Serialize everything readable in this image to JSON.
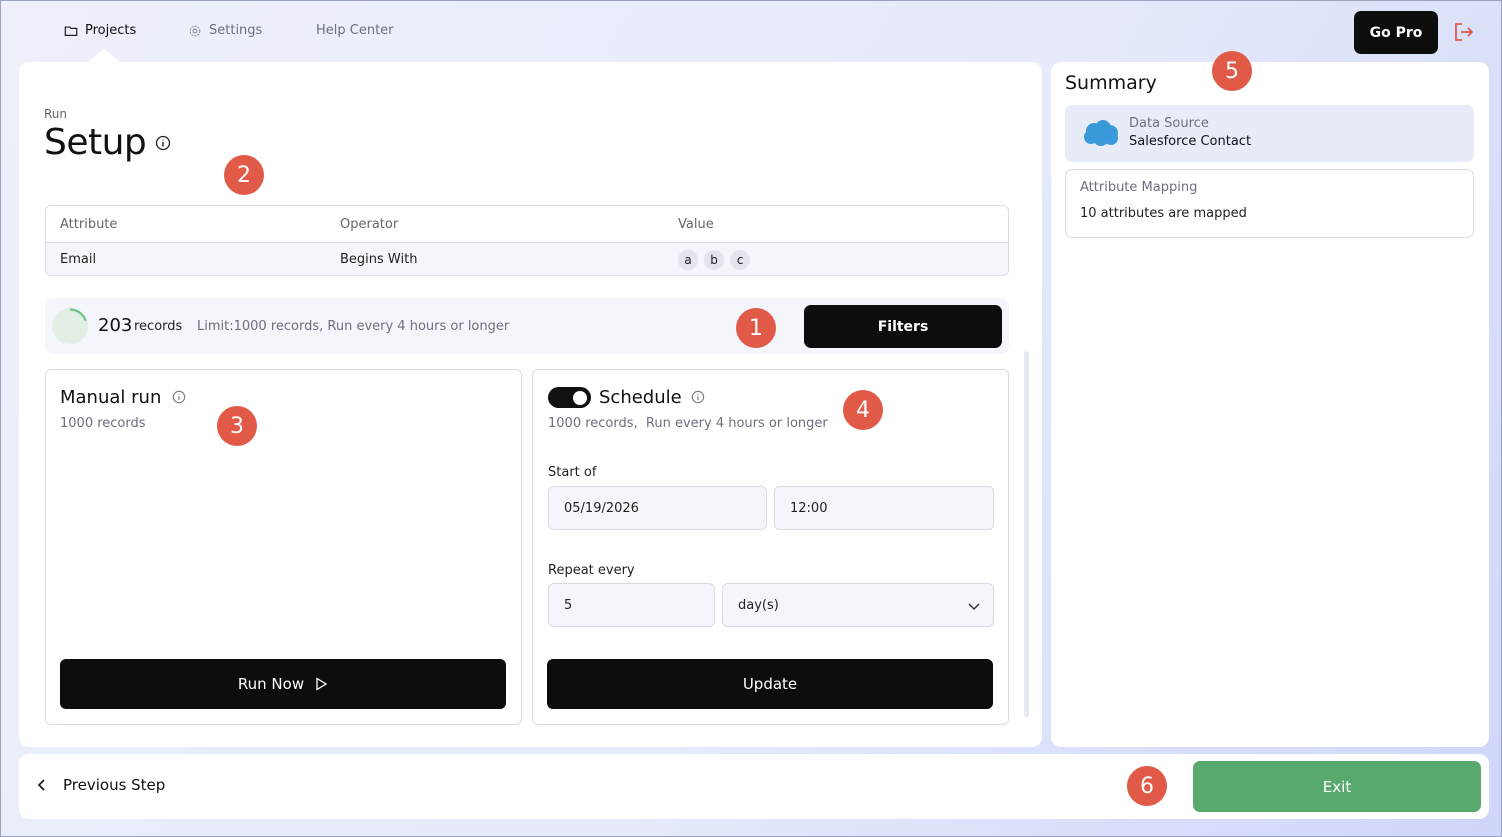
{
  "nav": {
    "items": [
      {
        "label": "Projects",
        "icon": "folder-icon",
        "active": true
      },
      {
        "label": "Settings",
        "icon": "gear-icon",
        "active": false
      },
      {
        "label": "Help Center",
        "icon": "",
        "active": false
      }
    ],
    "gopro_label": "Go Pro",
    "logout_icon": "logout-icon"
  },
  "main": {
    "breadcrumb": "Run",
    "title": "Setup",
    "filter_table": {
      "headers": [
        "Attribute",
        "Operator",
        "Value"
      ],
      "rows": [
        {
          "attribute": "Email",
          "operator": "Begins With",
          "values": [
            "a",
            "b",
            "c"
          ]
        }
      ]
    },
    "records": {
      "count": "203",
      "unit": "records",
      "limit_text": "Limit:1000 records, Run every 4 hours or longer",
      "progress_fraction": 0.2,
      "filters_label": "Filters"
    },
    "manual_run": {
      "title": "Manual run",
      "subtitle": "1000 records",
      "button_label": "Run Now"
    },
    "schedule": {
      "enabled": true,
      "title": "Schedule",
      "subtitle": "1000 records,  Run every 4 hours or longer",
      "start_label": "Start of",
      "start_date": "05/19/2026",
      "start_time": "12:00",
      "repeat_label": "Repeat every",
      "repeat_value": "5",
      "repeat_unit": "day(s)",
      "update_label": "Update"
    }
  },
  "summary": {
    "title": "Summary",
    "data_source_label": "Data Source",
    "data_source_value": "Salesforce Contact",
    "mapping_label": "Attribute Mapping",
    "mapping_value": "10 attributes are mapped"
  },
  "footer": {
    "previous_label": "Previous Step",
    "exit_label": "Exit"
  },
  "badges": [
    "1",
    "2",
    "3",
    "4",
    "5",
    "6"
  ],
  "colors": {
    "accent_dark": "#0d0d0d",
    "exit_green": "#57a96e",
    "badge_red": "#e05a47",
    "logout_red": "#e05a47",
    "progress_green": "#6cc38a"
  }
}
